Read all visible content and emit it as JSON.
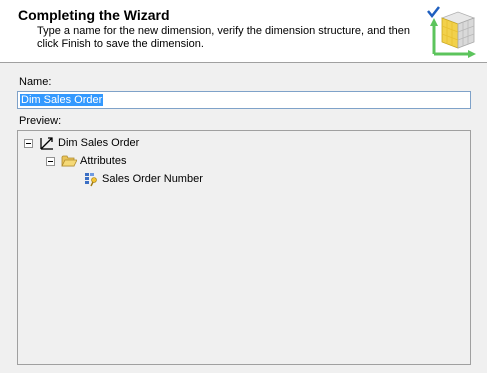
{
  "header": {
    "title": "Completing the Wizard",
    "description": "Type a name for the new dimension, verify the dimension structure, and then click Finish to save the dimension."
  },
  "name_field": {
    "label": "Name:",
    "value": "Dim Sales Order"
  },
  "preview": {
    "label": "Preview:",
    "tree": {
      "root": {
        "label": "Dim Sales Order",
        "icon": "dimension-icon",
        "expanded": true
      },
      "folder": {
        "label": "Attributes",
        "icon": "folder-open-icon",
        "expanded": true
      },
      "attribute": {
        "label": "Sales Order Number",
        "icon": "key-attribute-icon"
      }
    }
  },
  "colors": {
    "selection": "#3399ff",
    "input_border": "#7fa2c9",
    "folder": "#f5d06c",
    "cube": "#f2d14b",
    "checkmark": "#1f5fbf",
    "axis": "#5cc45c"
  }
}
